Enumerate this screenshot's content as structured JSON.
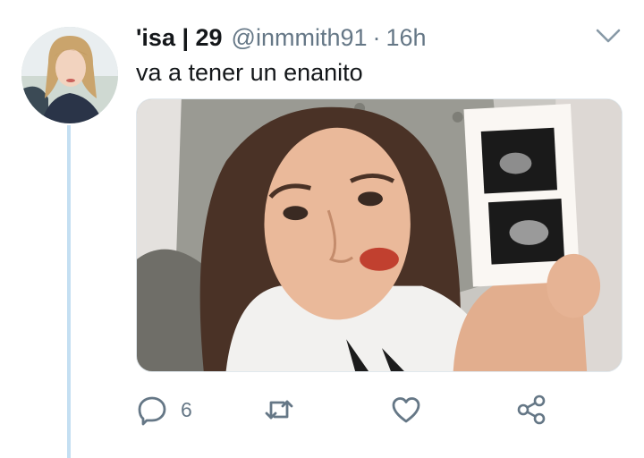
{
  "tweet": {
    "display_name": "'isa | 29",
    "handle": "@inmmith91",
    "separator": "·",
    "time": "16h",
    "text": "va a tener un enanito",
    "avatar_alt": "profile avatar",
    "media_alt": "photo of a woman holding an ultrasound picture"
  },
  "actions": {
    "reply_count": "6",
    "retweet_count": "",
    "like_count": ""
  },
  "icons": {
    "caret": "chevron-down-icon",
    "reply": "reply-bubble-icon",
    "retweet": "retweet-icon",
    "like": "heart-icon",
    "share": "share-icon"
  },
  "colors": {
    "text": "#14171a",
    "secondary": "#657786",
    "thread_line": "#c4dff2"
  }
}
